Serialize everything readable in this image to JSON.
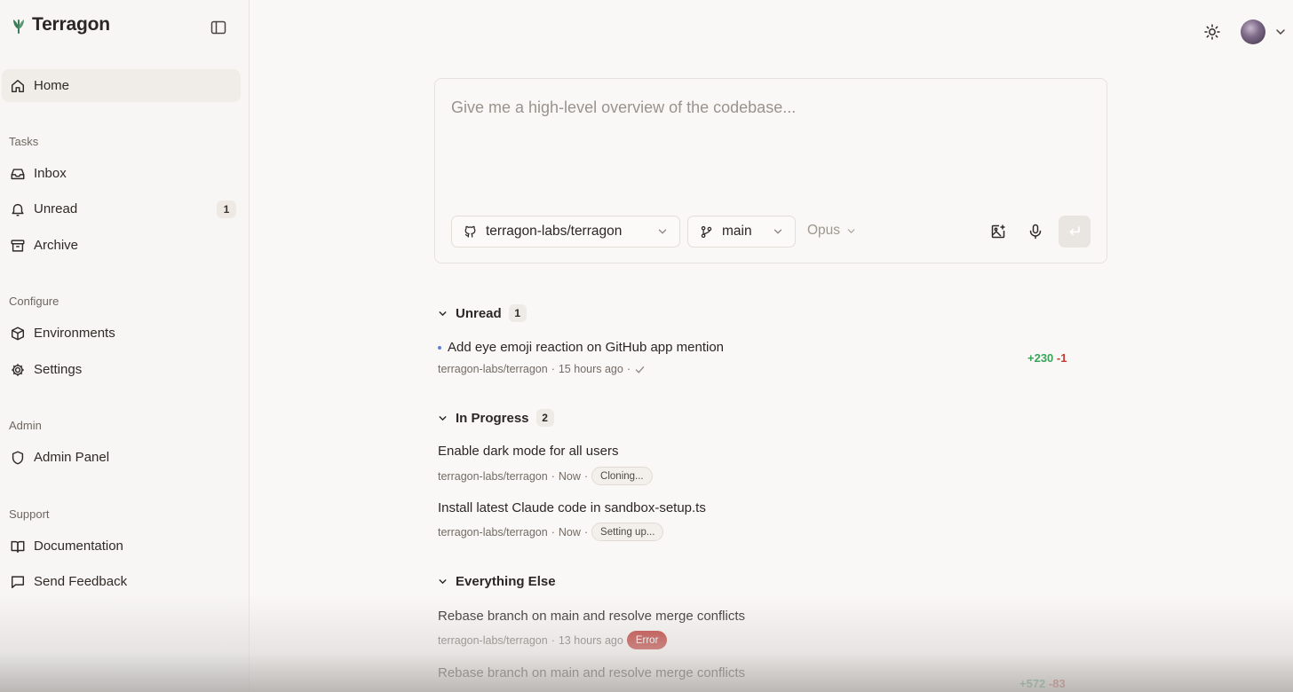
{
  "app": {
    "name": "Terragon"
  },
  "sidebar": {
    "home": "Home",
    "sections": {
      "tasks": "Tasks",
      "configure": "Configure",
      "admin": "Admin",
      "support": "Support"
    },
    "items": {
      "inbox": "Inbox",
      "unread": "Unread",
      "unread_count": "1",
      "archive": "Archive",
      "environments": "Environments",
      "settings": "Settings",
      "admin_panel": "Admin Panel",
      "documentation": "Documentation",
      "send_feedback": "Send Feedback"
    }
  },
  "composer": {
    "placeholder": "Give me a high-level overview of the codebase...",
    "repo": "terragon-labs/terragon",
    "branch": "main",
    "model": "Opus"
  },
  "groups": {
    "unread": {
      "title": "Unread",
      "count": "1",
      "tasks": [
        {
          "title": "Add eye emoji reaction on GitHub app mention",
          "repo": "terragon-labs/terragon",
          "time": "15 hours ago",
          "additions": "+230",
          "deletions": "-1"
        }
      ]
    },
    "in_progress": {
      "title": "In Progress",
      "count": "2",
      "tasks": [
        {
          "title": "Enable dark mode for all users",
          "repo": "terragon-labs/terragon",
          "time": "Now",
          "status": "Cloning..."
        },
        {
          "title": "Install latest Claude code in sandbox-setup.ts",
          "repo": "terragon-labs/terragon",
          "time": "Now",
          "status": "Setting up..."
        }
      ]
    },
    "everything_else": {
      "title": "Everything Else",
      "tasks": [
        {
          "title": "Rebase branch on main and resolve merge conflicts",
          "repo": "terragon-labs/terragon",
          "time": "13 hours ago",
          "status": "Error"
        },
        {
          "title": "Rebase branch on main and resolve merge conflicts",
          "additions": "+572",
          "deletions": "-83"
        }
      ]
    }
  },
  "colors": {
    "accent_green": "#3aa35a",
    "danger_red": "#c43c33",
    "error_chip": "#b92c26",
    "unread_dot": "#5b7fe0"
  },
  "icons": [
    "terragon-logo-icon",
    "sidebar-toggle-icon",
    "home-icon",
    "inbox-icon",
    "bell-icon",
    "archive-icon",
    "cube-icon",
    "gear-icon",
    "shield-icon",
    "book-icon",
    "message-icon",
    "sun-icon",
    "github-icon",
    "branch-icon",
    "chevron-down-icon",
    "image-plus-icon",
    "microphone-icon",
    "enter-icon",
    "check-icon"
  ]
}
